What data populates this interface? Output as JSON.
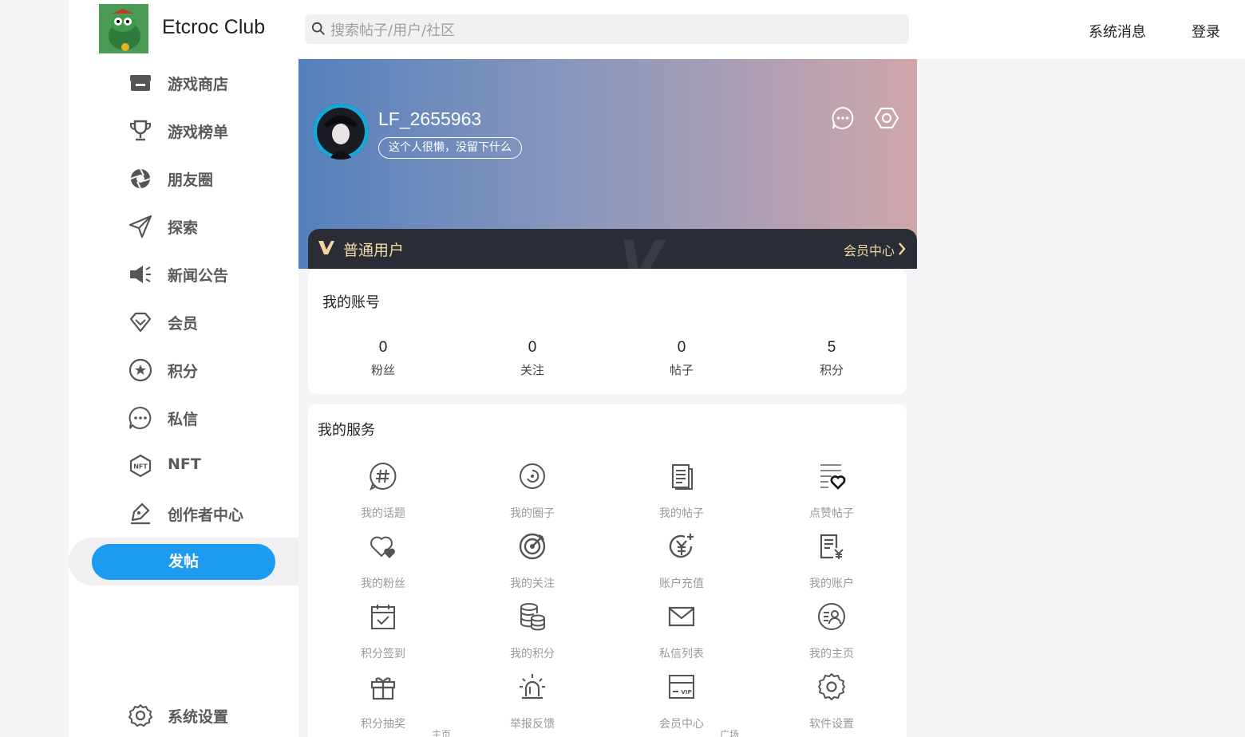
{
  "app": {
    "brand": "Etcroc Club"
  },
  "header": {
    "search_placeholder": "搜索帖子/用户/社区",
    "messages": "系统消息",
    "login": "登录"
  },
  "sidebar": {
    "items": [
      {
        "label": "游戏商店",
        "icon": "store-icon"
      },
      {
        "label": "游戏榜单",
        "icon": "trophy-icon"
      },
      {
        "label": "朋友圈",
        "icon": "aperture-icon"
      },
      {
        "label": "探索",
        "icon": "send-icon"
      },
      {
        "label": "新闻公告",
        "icon": "megaphone-icon"
      },
      {
        "label": "会员",
        "icon": "diamond-icon"
      },
      {
        "label": "积分",
        "icon": "star-circle-icon"
      },
      {
        "label": "私信",
        "icon": "chat-icon"
      },
      {
        "label": "NFT",
        "icon": "nft-icon"
      },
      {
        "label": "创作者中心",
        "icon": "pen-icon"
      }
    ],
    "post_button": "发帖",
    "settings": "系统设置"
  },
  "profile": {
    "username": "LF_2655963",
    "bio": "这个人很懒，没留下什么",
    "tier": "普通用户",
    "member_center": "会员中心"
  },
  "account": {
    "title": "我的账号",
    "stats": [
      {
        "value": "0",
        "label": "粉丝"
      },
      {
        "value": "0",
        "label": "关注"
      },
      {
        "value": "0",
        "label": "帖子"
      },
      {
        "value": "5",
        "label": "积分"
      }
    ]
  },
  "services": {
    "title": "我的服务",
    "items": [
      {
        "label": "我的话题",
        "icon": "hashtag-icon"
      },
      {
        "label": "我的圈子",
        "icon": "circle-icon"
      },
      {
        "label": "我的帖子",
        "icon": "documents-icon"
      },
      {
        "label": "点赞帖子",
        "icon": "liked-list-icon"
      },
      {
        "label": "我的粉丝",
        "icon": "hearts-icon"
      },
      {
        "label": "我的关注",
        "icon": "target-icon"
      },
      {
        "label": "账户充值",
        "icon": "yen-plus-icon"
      },
      {
        "label": "我的账户",
        "icon": "bill-icon"
      },
      {
        "label": "积分签到",
        "icon": "calendar-check-icon"
      },
      {
        "label": "我的积分",
        "icon": "coins-icon"
      },
      {
        "label": "私信列表",
        "icon": "mail-icon"
      },
      {
        "label": "我的主页",
        "icon": "profile-circle-icon"
      },
      {
        "label": "积分抽奖",
        "icon": "gift-icon"
      },
      {
        "label": "举报反馈",
        "icon": "alarm-icon"
      },
      {
        "label": "会员中心",
        "icon": "vip-card-icon"
      },
      {
        "label": "软件设置",
        "icon": "settings-icon"
      }
    ]
  },
  "footer_ghost": {
    "left": "主页",
    "right": "广场"
  }
}
